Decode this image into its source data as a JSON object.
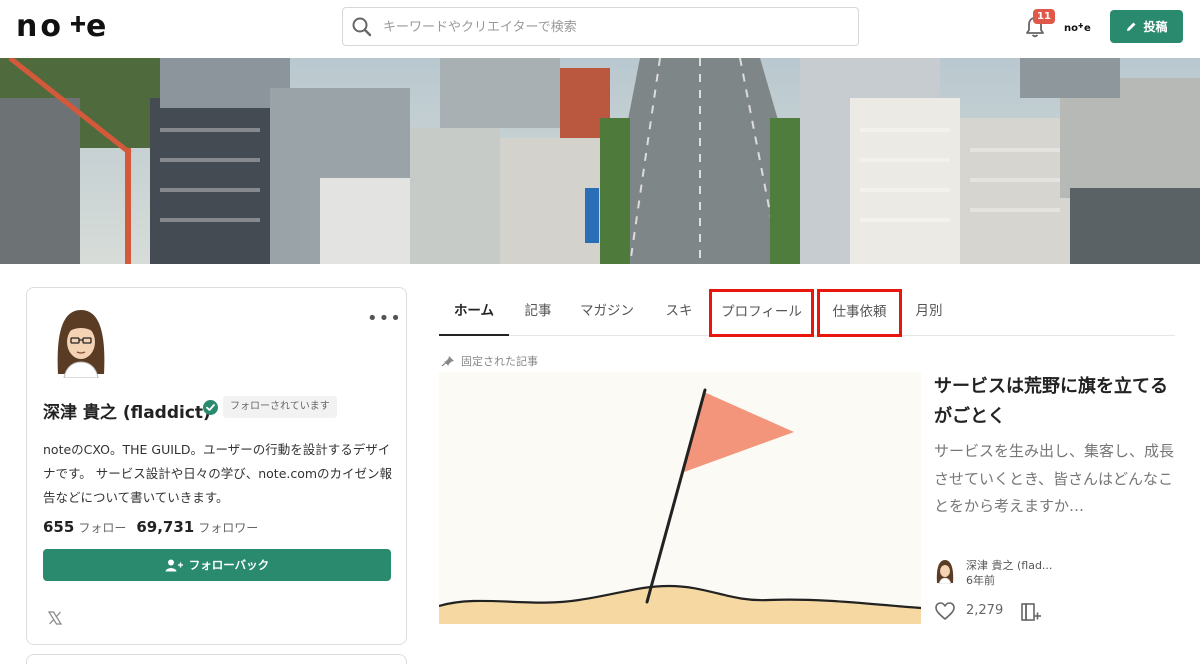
{
  "header": {
    "logo_text": "note",
    "search_placeholder": "キーワードやクリエイターで検索",
    "notification_count": "11",
    "mini_logo_text": "note",
    "post_label": "投稿"
  },
  "profile": {
    "name": "深津 貴之 (fladdict)",
    "followed_tag": "フォローされています",
    "bio": "noteのCXO。THE GUILD。ユーザーの行動を設計するデザイナです。 サービス設計や日々の学び、note.comのカイゼン報告などについて書いていきます。",
    "following_count": "655",
    "following_label": "フォロー",
    "followers_count": "69,731",
    "followers_label": "フォロワー",
    "follow_back_label": "フォローバック"
  },
  "tabs": [
    {
      "label": "ホーム"
    },
    {
      "label": "記事"
    },
    {
      "label": "マガジン"
    },
    {
      "label": "スキ"
    },
    {
      "label": "プロフィール"
    },
    {
      "label": "仕事依頼"
    },
    {
      "label": "月別"
    }
  ],
  "pinned": {
    "label": "固定された記事",
    "title": "サービスは荒野に旗を立てるがごとく",
    "description": "サービスを生み出し、集客し、成長させていくとき、皆さんはどんなことをから考えますか…",
    "author": "深津 貴之 (flad...",
    "time": "6年前",
    "likes": "2,279"
  },
  "colors": {
    "accent": "#2a8a6e",
    "highlight_box": "#e8160c",
    "badge": "#e0584a",
    "flag": "#f28a6e"
  }
}
